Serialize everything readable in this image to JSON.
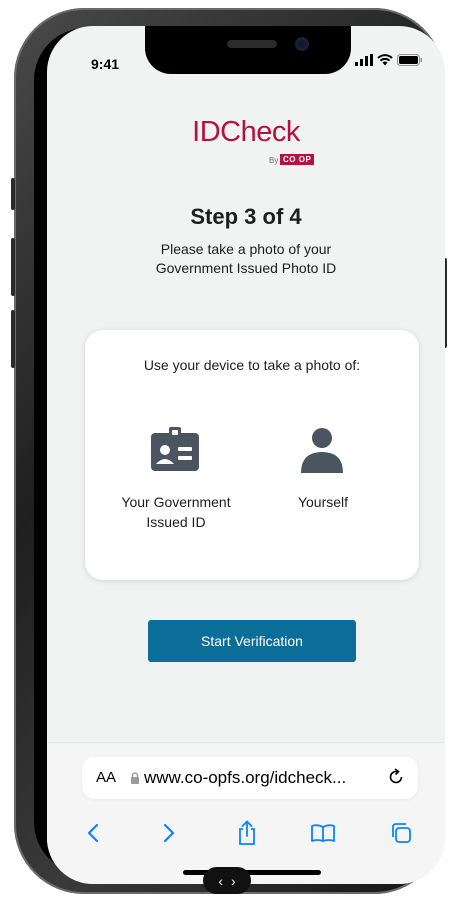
{
  "status_bar": {
    "time": "9:41"
  },
  "logo": {
    "main": "IDCheck",
    "by": "By",
    "brand": "CO OP"
  },
  "step": {
    "title": "Step 3 of 4",
    "description": "Please take a photo of your Government Issued Photo ID"
  },
  "card": {
    "title": "Use your device to take a photo of:",
    "items": [
      {
        "label": "Your Government Issued ID",
        "icon": "id-card-icon"
      },
      {
        "label": "Yourself",
        "icon": "person-icon"
      }
    ]
  },
  "start_button": {
    "label": "Start Verification"
  },
  "browser": {
    "text_size_label": "AA",
    "url": "www.co-opfs.org/idcheck...",
    "toolbar": [
      "back-icon",
      "forward-icon",
      "share-icon",
      "bookmarks-icon",
      "tabs-icon"
    ]
  },
  "colors": {
    "brand": "#b4123e",
    "button": "#0b6e99",
    "icon": "#4a5560",
    "link": "#0a84ff"
  }
}
